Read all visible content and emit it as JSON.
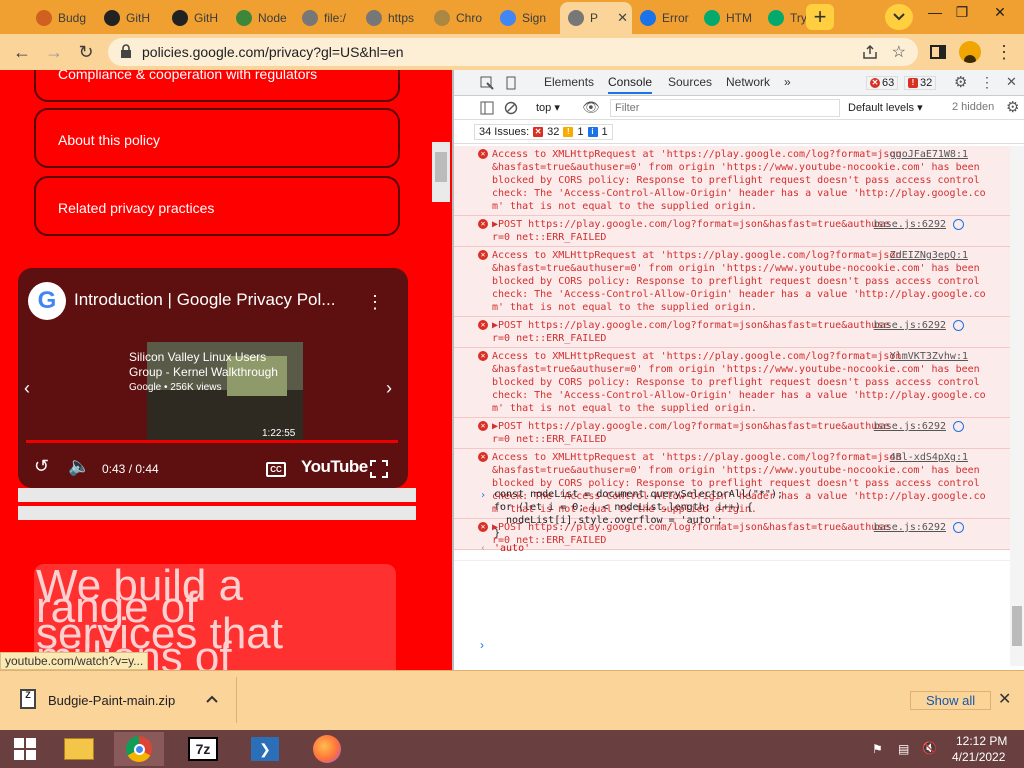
{
  "tabs": [
    {
      "title": "Budg",
      "icon": "budgie-icon",
      "color": "#d06020"
    },
    {
      "title": "GitH",
      "icon": "github-icon",
      "color": "#222222"
    },
    {
      "title": "GitH",
      "icon": "github-icon",
      "color": "#222222"
    },
    {
      "title": "Node",
      "icon": "node-icon",
      "color": "#3c873a"
    },
    {
      "title": "file:/",
      "icon": "globe-icon",
      "color": "#777777"
    },
    {
      "title": "https",
      "icon": "globe-icon",
      "color": "#777777"
    },
    {
      "title": "Chro",
      "icon": "chrome-icon",
      "color": "#aa8844"
    },
    {
      "title": "Sign",
      "icon": "google-icon",
      "color": "#4285f4"
    },
    {
      "title": "P",
      "icon": "globe-icon",
      "color": "#777777",
      "active": true
    },
    {
      "title": "Error",
      "icon": "play-icon",
      "color": "#1a73e8"
    },
    {
      "title": "HTM",
      "icon": "w3schools-icon",
      "color": "#04aa6d"
    },
    {
      "title": "Tryit",
      "icon": "w3schools-icon",
      "color": "#04aa6d"
    }
  ],
  "address": {
    "url": "policies.google.com/privacy?gl=US&hl=en"
  },
  "page": {
    "cards": [
      "Compliance & cooperation with regulators",
      "About this policy",
      "Related privacy practices"
    ],
    "video": {
      "title": "Introduction | Google Privacy Pol...",
      "rec_title": "Silicon Valley Linux Users Group - Kernel Walkthrough",
      "rec_meta": "Google • 256K views",
      "rec_duration": "1:22:55",
      "time": "0:43 / 0:44",
      "brand": "YouTube"
    },
    "big_text": [
      "We build a",
      "range of",
      "services that",
      "millions of"
    ],
    "status_url": "youtube.com/watch?v=y..."
  },
  "devtools": {
    "tabs": [
      "Elements",
      "Console",
      "Sources",
      "Network"
    ],
    "selected_tab": "Console",
    "error_count": "63",
    "warning_count": "32",
    "context": "top",
    "filter_placeholder": "Filter",
    "levels": "Default levels",
    "hidden": "2 hidden",
    "issues_label": "34 Issues:",
    "issues_err": "32",
    "issues_warn": "1",
    "issues_info": "1",
    "messages": [
      {
        "type": "cors",
        "lines": [
          "Access to XMLHttpRequest at 'https://play.google.com/log?format=json",
          "&hasfast=true&authuser=0' from origin 'https://www.youtube-nocookie.com' has been",
          "blocked by CORS policy: Response to preflight request doesn't pass access control",
          "check: The 'Access-Control-Allow-Origin' header has a value 'http://play.google.co",
          "m' that is not equal to the supplied origin."
        ],
        "source": "ggoJFaE71W8:1"
      },
      {
        "type": "post",
        "lines": [
          "▶POST https://play.google.com/log?format=json&hasfast=true&authuse",
          "r=0 net::ERR_FAILED"
        ],
        "source": "base.js:6292"
      },
      {
        "type": "cors",
        "lines": [
          "Access to XMLHttpRequest at 'https://play.google.com/log?format=json",
          "&hasfast=true&authuser=0' from origin 'https://www.youtube-nocookie.com' has been",
          "blocked by CORS policy: Response to preflight request doesn't pass access control",
          "check: The 'Access-Control-Allow-Origin' header has a value 'http://play.google.co",
          "m' that is not equal to the supplied origin."
        ],
        "source": "ZdEIZNg3epQ:1"
      },
      {
        "type": "post",
        "lines": [
          "▶POST https://play.google.com/log?format=json&hasfast=true&authuse",
          "r=0 net::ERR_FAILED"
        ],
        "source": "base.js:6292"
      },
      {
        "type": "cors",
        "lines": [
          "Access to XMLHttpRequest at 'https://play.google.com/log?format=json",
          "&hasfast=true&authuser=0' from origin 'https://www.youtube-nocookie.com' has been",
          "blocked by CORS policy: Response to preflight request doesn't pass access control",
          "check: The 'Access-Control-Allow-Origin' header has a value 'http://play.google.co",
          "m' that is not equal to the supplied origin."
        ],
        "source": "YlmVKT3Zvhw:1"
      },
      {
        "type": "post",
        "lines": [
          "▶POST https://play.google.com/log?format=json&hasfast=true&authuse",
          "r=0 net::ERR_FAILED"
        ],
        "source": "base.js:6292"
      },
      {
        "type": "cors",
        "lines": [
          "Access to XMLHttpRequest at 'https://play.google.com/log?format=json",
          "&hasfast=true&authuser=0' from origin 'https://www.youtube-nocookie.com' has been",
          "blocked by CORS policy: Response to preflight request doesn't pass access control",
          "check: The 'Access-Control-Allow-Origin' header has a value 'http://play.google.co",
          "m' that is not equal to the supplied origin."
        ],
        "source": "4Bl-xdS4pXg:1"
      },
      {
        "type": "post",
        "lines": [
          "▶POST https://play.google.com/log?format=json&hasfast=true&authuse",
          "r=0 net::ERR_FAILED"
        ],
        "source": "base.js:6292"
      }
    ],
    "command": [
      "const nodeList = document.querySelectorAll(\"*\");",
      "for (let i = 0; i < nodeList.length; i++) {",
      "  nodeList[i].style.overflow = 'auto';",
      "}"
    ],
    "result": "'auto'"
  },
  "downloads": {
    "file": "Budgie-Paint-main.zip",
    "show_all": "Show all"
  },
  "taskbar": {
    "time": "12:12 PM",
    "date": "4/21/2022"
  },
  "colors": {
    "tabstrip": "#f0a030",
    "toolbar": "#fbd49a",
    "page_red": "#ff0000",
    "taskbar": "#6a3f3f"
  }
}
